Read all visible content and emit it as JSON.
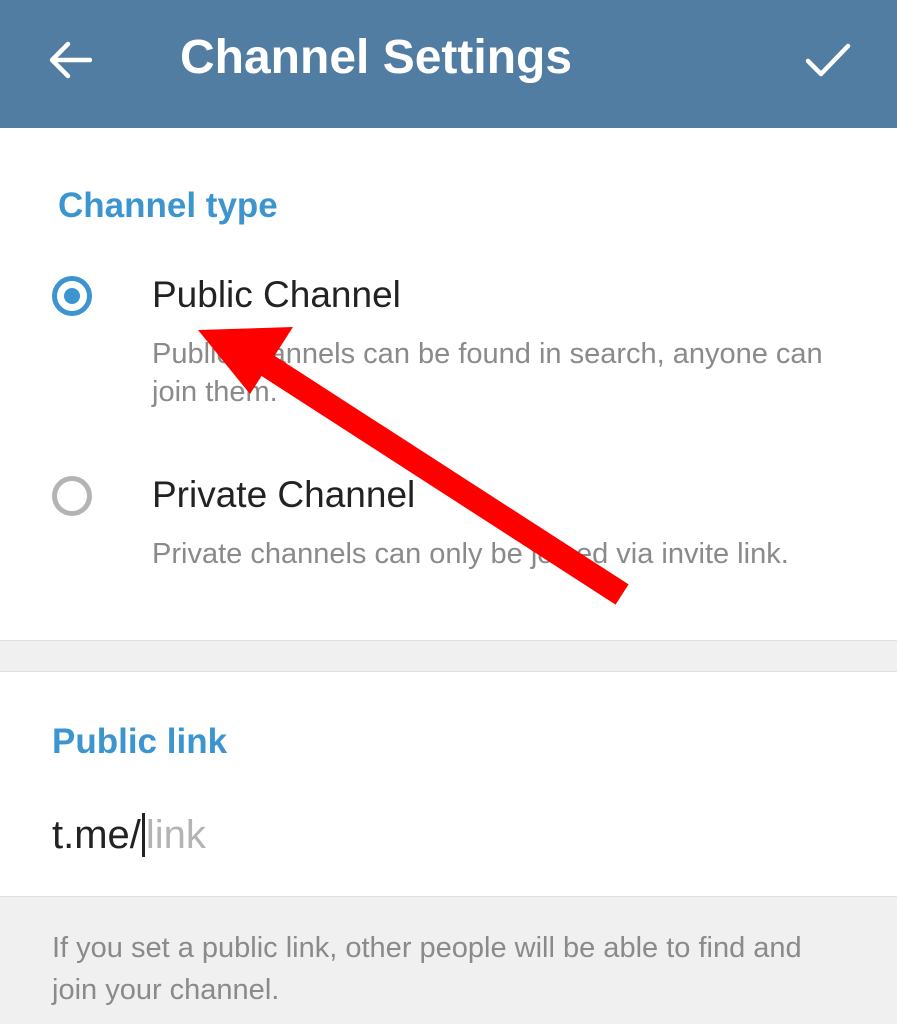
{
  "appbar": {
    "title": "Channel Settings",
    "back_icon": "arrow-left-icon",
    "done_icon": "check-icon",
    "background": "#527da3"
  },
  "channel_type": {
    "header": "Channel type",
    "options": [
      {
        "label": "Public Channel",
        "description": "Public channels can be found in search, anyone can join them.",
        "selected": true
      },
      {
        "label": "Private Channel",
        "description": "Private channels can only be joined via invite link.",
        "selected": false
      }
    ]
  },
  "public_link": {
    "header": "Public link",
    "prefix": "t.me/",
    "value": "",
    "placeholder": "link",
    "hint": "If you set a public link, other people will be able to find and join your channel."
  },
  "colors": {
    "accent": "#3d95cf",
    "annotation_arrow": "#ff0000"
  }
}
